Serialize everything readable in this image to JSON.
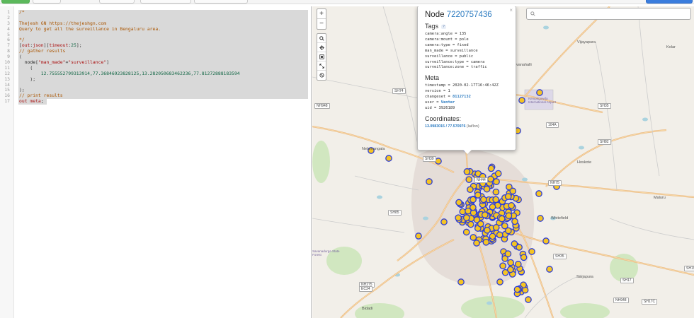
{
  "editor": {
    "lines": [
      {
        "n": "1",
        "tokens": [
          {
            "t": "/*",
            "c": "comment"
          }
        ],
        "sel": true
      },
      {
        "n": "2",
        "tokens": [],
        "sel": true
      },
      {
        "n": "3",
        "tokens": [
          {
            "t": "Thejesh GN https://thejeshgn.com",
            "c": "comment"
          }
        ],
        "sel": true
      },
      {
        "n": "4",
        "tokens": [
          {
            "t": "Query to get all the surveillance in Bengaluru area.",
            "c": "comment"
          }
        ],
        "sel": true
      },
      {
        "n": "5",
        "tokens": [],
        "sel": true
      },
      {
        "n": "6",
        "tokens": [
          {
            "t": "*/",
            "c": "comment"
          }
        ],
        "sel": true
      },
      {
        "n": "7",
        "tokens": [
          {
            "t": "[",
            "c": "bracket"
          },
          {
            "t": "out",
            "c": "kw"
          },
          {
            "t": ":",
            "c": "plain"
          },
          {
            "t": "json",
            "c": "kw"
          },
          {
            "t": "][",
            "c": "bracket"
          },
          {
            "t": "timeout",
            "c": "kw"
          },
          {
            "t": ":",
            "c": "plain"
          },
          {
            "t": "25",
            "c": "num"
          },
          {
            "t": "];",
            "c": "bracket"
          }
        ],
        "sel": true
      },
      {
        "n": "8",
        "tokens": [
          {
            "t": "// gather results",
            "c": "comment"
          }
        ],
        "sel": true
      },
      {
        "n": "9",
        "tokens": [
          {
            "t": "(",
            "c": "bracket"
          }
        ],
        "sel": true
      },
      {
        "n": "10",
        "tokens": [
          {
            "t": "  node",
            "c": "plain"
          },
          {
            "t": "[",
            "c": "bracket"
          },
          {
            "t": "\"man_made\"",
            "c": "str"
          },
          {
            "t": "=",
            "c": "plain"
          },
          {
            "t": "\"surveillance\"",
            "c": "str"
          },
          {
            "t": "]",
            "c": "bracket"
          }
        ],
        "sel": true
      },
      {
        "n": "11",
        "tokens": [
          {
            "t": "    (",
            "c": "bracket"
          }
        ],
        "sel": true
      },
      {
        "n": "12",
        "tokens": [
          {
            "t": "        12.755552799313914,77.36846923828125,13.282050683462236,77.81272888183594",
            "c": "num"
          }
        ],
        "sel": true
      },
      {
        "n": "13",
        "tokens": [
          {
            "t": "    );",
            "c": "bracket"
          }
        ],
        "sel": true
      },
      {
        "n": "14",
        "tokens": [],
        "sel": true
      },
      {
        "n": "15",
        "tokens": [
          {
            "t": ");",
            "c": "bracket"
          }
        ],
        "sel": true
      },
      {
        "n": "16",
        "tokens": [
          {
            "t": "// print results",
            "c": "comment"
          }
        ],
        "sel": true
      },
      {
        "n": "17",
        "tokens": [
          {
            "t": "out meta",
            "c": "kw"
          },
          {
            "t": ";",
            "c": "plain"
          }
        ],
        "sel": "short"
      }
    ]
  },
  "map": {
    "zoom_in": "+",
    "zoom_out": "−",
    "tools": [
      "search-icon",
      "locate-icon",
      "fit-bounds-icon",
      "fullscreen-icon",
      "clear-data-icon"
    ],
    "search": {
      "placeholder": ""
    },
    "popup": {
      "close": "×",
      "title_prefix": "Node ",
      "node_id": "7220757436",
      "tags_heading": "Tags",
      "tags_badge": "?",
      "tags": [
        "camera:angle = 135",
        "camera:mount = pole",
        "camera:type = fixed",
        "man_made = surveillance",
        "surveillance = public",
        "surveillance:type = camera",
        "surveillance:zone = traffic"
      ],
      "meta_heading": "Meta",
      "meta": [
        {
          "k": "timestamp = ",
          "v": "2020-02-17T16:46:42Z",
          "link": false
        },
        {
          "k": "version = ",
          "v": "1",
          "link": false
        },
        {
          "k": "changeset = ",
          "v": "81127132",
          "link": true
        },
        {
          "k": "user = ",
          "v": "Venter",
          "link": true
        },
        {
          "k": "uid = ",
          "v": "3926189",
          "link": false
        }
      ],
      "coords_heading": "Coordinates:",
      "coords_value": "13.0983015 / 77.570976",
      "coords_suffix": " (lat/lon)"
    },
    "labels": [
      {
        "t": "Vijayapura"
      },
      {
        "t": "Devanahalli"
      },
      {
        "t": "Kempegowda International Airport"
      },
      {
        "t": "Nelamangala"
      },
      {
        "t": "Hoskote"
      },
      {
        "t": "Maluru"
      },
      {
        "t": "Whitefield"
      },
      {
        "t": "Sarjapura"
      },
      {
        "t": "Bidadi"
      },
      {
        "t": "Kolar"
      },
      {
        "t": "Savanadurga State Forest"
      }
    ],
    "shields": [
      "NH44",
      "SH35",
      "SH74",
      "NH948",
      "SH82",
      "104A",
      "SH39",
      "NH75",
      "SH85",
      "SH35",
      "NH275",
      "EC34",
      "SH17",
      "NH948",
      "SH17C",
      "SH19"
    ],
    "colors": {
      "marker_fill": "#f5c423",
      "marker_stroke": "#2d3ed8",
      "selected_fill": "#e07a1f",
      "water": "#aad3df",
      "park": "#c8e5b5",
      "urban": "#e0d5d0"
    }
  }
}
